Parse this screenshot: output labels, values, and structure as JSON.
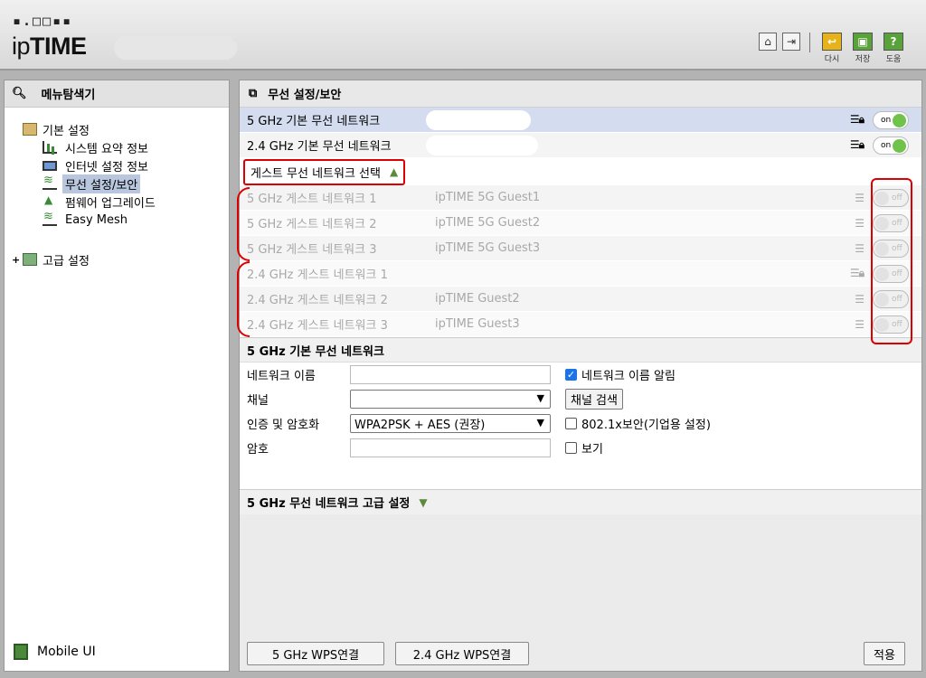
{
  "header": {
    "logo_dots": "▪.□□▪▪",
    "logo_prefix": "ip",
    "logo_main": "TIME",
    "buttons": [
      {
        "label": "다시",
        "color": "#e8b21a"
      },
      {
        "label": "저장",
        "color": "#5aa23a"
      },
      {
        "label": "도움",
        "color": "#5aa23a"
      }
    ]
  },
  "sidebar": {
    "title": "메뉴탐색기",
    "group_basic": "기본 설정",
    "items": [
      {
        "label": "시스템 요약 정보"
      },
      {
        "label": "인터넷 설정 정보"
      },
      {
        "label": "무선 설정/보안"
      },
      {
        "label": "펌웨어 업그레이드"
      },
      {
        "label": "Easy Mesh"
      }
    ],
    "group_advanced": "고급 설정",
    "mobile": "Mobile UI"
  },
  "main": {
    "title": "무선 설정/보안",
    "basic_networks": [
      {
        "name": "5 GHz 기본 무선 네트워크",
        "toggle": "on"
      },
      {
        "name": "2.4 GHz 기본 무선 네트워크",
        "toggle": "on"
      }
    ],
    "guest_select_label": "게스트 무선 네트워크 선택",
    "guest_networks": [
      {
        "name": "5 GHz 게스트 네트워크 1",
        "ssid": "ipTIME 5G Guest1",
        "toggle": "off"
      },
      {
        "name": "5 GHz 게스트 네트워크 2",
        "ssid": "ipTIME 5G Guest2",
        "toggle": "off"
      },
      {
        "name": "5 GHz 게스트 네트워크 3",
        "ssid": "ipTIME 5G Guest3",
        "toggle": "off"
      },
      {
        "name": "2.4 GHz 게스트 네트워크 1",
        "ssid": "",
        "toggle": "off"
      },
      {
        "name": "2.4 GHz 게스트 네트워크 2",
        "ssid": "ipTIME Guest2",
        "toggle": "off"
      },
      {
        "name": "2.4 GHz 게스트 네트워크 3",
        "ssid": "ipTIME Guest3",
        "toggle": "off"
      }
    ],
    "form": {
      "title": "5 GHz 기본 무선 네트워크",
      "network_name_label": "네트워크 이름",
      "broadcast_label": "네트워크 이름 알림",
      "channel_label": "채널",
      "channel_search": "채널 검색",
      "auth_label": "인증 및 암호화",
      "auth_value": "WPA2PSK + AES (권장)",
      "enterprise_label": "802.1x보안(기업용 설정)",
      "password_label": "암호",
      "show_label": "보기"
    },
    "advanced_title": "5 GHz 무선 네트워크 고급 설정",
    "buttons": {
      "wps5": "5 GHz WPS연결",
      "wps24": "2.4 GHz WPS연결",
      "apply": "적용"
    }
  }
}
